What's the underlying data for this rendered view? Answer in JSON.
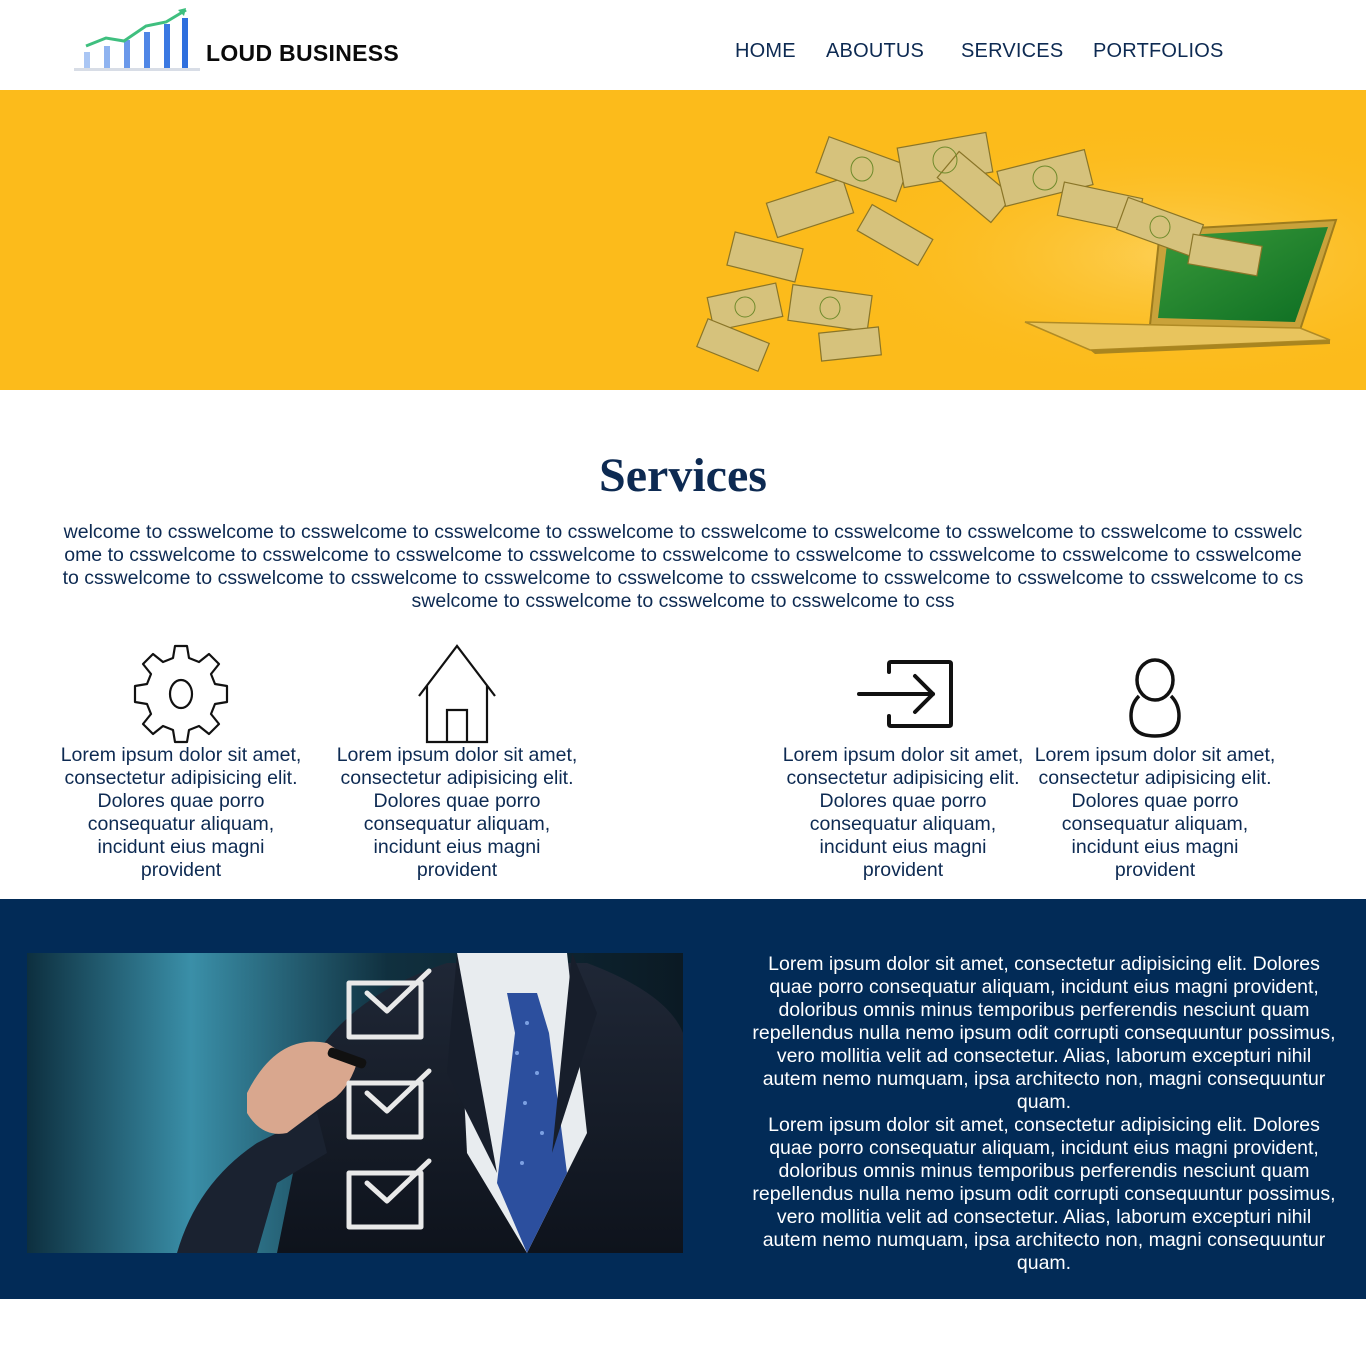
{
  "header": {
    "brand": "LOUD BUSINESS",
    "logo_icon": "bar-chart-growth-icon",
    "nav": [
      "HOME",
      "ABOUTUS",
      "SERVICES",
      "PORTFOLIOS"
    ]
  },
  "hero": {
    "image": "money-flying-into-laptop",
    "background_color": "#fcbb1b"
  },
  "services": {
    "title": "Services",
    "intro": "welcome to csswelcome to csswelcome to csswelcome to csswelcome to csswelcome to csswelcome to csswelcome to csswelcome to csswelcome to csswelcome to csswelcome to csswelcome to csswelcome to csswelcome to csswelcome to csswelcome to csswelcome to csswelcome to csswelcome to csswelcome to csswelcome to csswelcome to csswelcome to csswelcome to csswelcome to csswelcome to csswelcome to csswelcome to csswelcome to csswelcome to csswelcome to css",
    "items": [
      {
        "icon": "gear-icon",
        "text": "Lorem ipsum dolor sit amet, consectetur adipisicing elit. Dolores quae porro consequatur aliquam, incidunt eius magni provident"
      },
      {
        "icon": "home-icon",
        "text": "Lorem ipsum dolor sit amet, consectetur adipisicing elit. Dolores quae porro consequatur aliquam, incidunt eius magni provident"
      },
      {
        "icon": "sign-in-icon",
        "text": "Lorem ipsum dolor sit amet, consectetur adipisicing elit. Dolores quae porro consequatur aliquam, incidunt eius magni provident"
      },
      {
        "icon": "user-icon",
        "text": "Lorem ipsum dolor sit amet, consectetur adipisicing elit. Dolores quae porro consequatur aliquam, incidunt eius magni provident"
      }
    ]
  },
  "about": {
    "background_color": "#022b57",
    "image": "businessman-checklist-photo",
    "paragraphs": [
      "Lorem ipsum dolor sit amet, consectetur adipisicing elit. Dolores quae porro consequatur aliquam, incidunt eius magni provident, doloribus omnis minus temporibus perferendis nesciunt quam repellendus nulla nemo ipsum odit corrupti consequuntur possimus, vero mollitia velit ad consectetur. Alias, laborum excepturi nihil autem nemo numquam, ipsa architecto non, magni consequuntur quam.",
      "Lorem ipsum dolor sit amet, consectetur adipisicing elit. Dolores quae porro consequatur aliquam, incidunt eius magni provident, doloribus omnis minus temporibus perferendis nesciunt quam repellendus nulla nemo ipsum odit corrupti consequuntur possimus, vero mollitia velit ad consectetur. Alias, laborum excepturi nihil autem nemo numquam, ipsa architecto non, magni consequuntur quam."
    ]
  }
}
